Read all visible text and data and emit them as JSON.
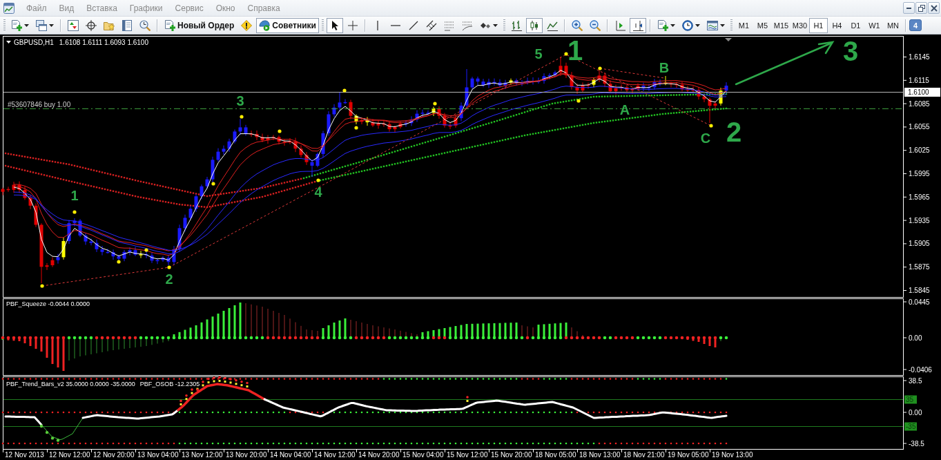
{
  "menu": [
    {
      "label": "Файл"
    },
    {
      "label": "Вид"
    },
    {
      "label": "Вставка"
    },
    {
      "label": "Графики"
    },
    {
      "label": "Сервис"
    },
    {
      "label": "Окно"
    },
    {
      "label": "Справка"
    }
  ],
  "toolbar": {
    "new_order": "Новый Ордер",
    "experts": {
      "label": "Советники",
      "on": true
    },
    "cursor_modes": [
      {
        "selected": true
      },
      {
        "selected": false
      }
    ],
    "chart_types": [
      {
        "selected": false
      },
      {
        "selected": true
      },
      {
        "selected": false
      }
    ],
    "chart_toggles": [
      {
        "on": false
      },
      {
        "on": true
      }
    ],
    "timeframes": [
      {
        "label": "M1",
        "selected": false
      },
      {
        "label": "M5",
        "selected": false
      },
      {
        "label": "M15",
        "selected": false
      },
      {
        "label": "M30",
        "selected": false
      },
      {
        "label": "H1",
        "selected": true
      },
      {
        "label": "H4",
        "selected": false
      },
      {
        "label": "D1",
        "selected": false
      },
      {
        "label": "W1",
        "selected": false
      },
      {
        "label": "MN",
        "selected": false
      }
    ],
    "notifications": "4"
  },
  "chart": {
    "symbol": "GBPUSD,H1",
    "quote": "1.6108 1.6111 1.6093 1.6100",
    "order": "#53607846 buy 1.00",
    "current_price": "1.6100",
    "price_axis": [
      "1.6145",
      "1.6115",
      "1.6085",
      "1.6055",
      "1.6025",
      "1.5995",
      "1.5965",
      "1.5935",
      "1.5905",
      "1.5875",
      "1.5845"
    ],
    "annotations": [
      {
        "text": "1",
        "kind": "wave"
      },
      {
        "text": "2",
        "kind": "wave"
      },
      {
        "text": "3",
        "kind": "wave"
      },
      {
        "text": "4",
        "kind": "wave"
      },
      {
        "text": "5",
        "kind": "wave"
      },
      {
        "text": "1",
        "kind": "major"
      },
      {
        "text": "A",
        "kind": "wave"
      },
      {
        "text": "B",
        "kind": "wave"
      },
      {
        "text": "C",
        "kind": "wave"
      },
      {
        "text": "2",
        "kind": "major"
      },
      {
        "text": "3",
        "kind": "major"
      }
    ]
  },
  "indicators": [
    {
      "labels": [
        "PBF_Squeeze -0.0044 0.0000"
      ],
      "axis": [
        "0.0445",
        "0.00",
        "-0.0406"
      ]
    },
    {
      "labels": [
        "PBF_Trend_Bars_v2 35.0000 0.0000 -35.0000",
        "PBF_OSOB -12.2305"
      ],
      "axis": [
        "38.5",
        "0.00",
        "-38.5"
      ],
      "levels": [
        "35",
        "-35"
      ]
    }
  ],
  "time_axis": [
    "12 Nov 2013",
    "12 Nov 12:00",
    "12 Nov 20:00",
    "13 Nov 04:00",
    "13 Nov 12:00",
    "13 Nov 20:00",
    "14 Nov 04:00",
    "14 Nov 12:00",
    "14 Nov 20:00",
    "15 Nov 04:00",
    "15 Nov 12:00",
    "15 Nov 20:00",
    "18 Nov 05:00",
    "18 Nov 13:00",
    "18 Nov 21:00",
    "19 Nov 05:00",
    "19 Nov 13:00"
  ]
}
